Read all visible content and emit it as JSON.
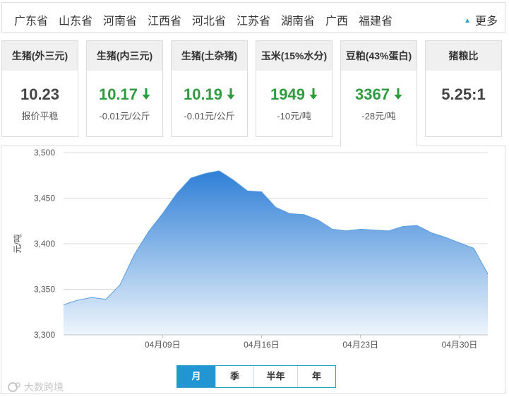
{
  "provinces": [
    "广东省",
    "山东省",
    "河南省",
    "江西省",
    "河北省",
    "江苏省",
    "湖南省",
    "广西",
    "福建省"
  ],
  "more_label": "更多",
  "cards": [
    {
      "title": "生猪(外三元)",
      "value": "10.23",
      "sub": "报价平稳",
      "trend": "flat"
    },
    {
      "title": "生猪(内三元)",
      "value": "10.17",
      "sub": "-0.01元/公斤",
      "trend": "down"
    },
    {
      "title": "生猪(土杂猪)",
      "value": "10.19",
      "sub": "-0.01元/公斤",
      "trend": "down"
    },
    {
      "title": "玉米(15%水分)",
      "value": "1949",
      "sub": "-10元/吨",
      "trend": "down"
    },
    {
      "title": "豆粕(43%蛋白)",
      "value": "3367",
      "sub": "-28元/吨",
      "trend": "down"
    },
    {
      "title": "猪粮比",
      "value": "5.25:1",
      "sub": "",
      "trend": "flat"
    }
  ],
  "active_card": 4,
  "colors": {
    "down": "#2e9b3e",
    "accent": "#2196d3",
    "area_top": "#2f7fd6",
    "area_bottom": "#eef5fc"
  },
  "chart_data": {
    "type": "area",
    "ylabel": "元/吨",
    "ylim": [
      3300,
      3500
    ],
    "yticks": [
      "3,500",
      "3,450",
      "3,400",
      "3,350",
      "3,300"
    ],
    "ytick_values": [
      3500,
      3450,
      3400,
      3350,
      3300
    ],
    "xtick_labels": [
      "04月09日",
      "04月16日",
      "04月23日",
      "04月30日"
    ],
    "xtick_index": [
      7,
      14,
      21,
      28
    ],
    "x": [
      "04月02日",
      "04月03日",
      "04月04日",
      "04月05日",
      "04月06日",
      "04月07日",
      "04月08日",
      "04月09日",
      "04月10日",
      "04月11日",
      "04月12日",
      "04月13日",
      "04月14日",
      "04月15日",
      "04月16日",
      "04月17日",
      "04月18日",
      "04月19日",
      "04月20日",
      "04月21日",
      "04月22日",
      "04月23日",
      "04月24日",
      "04月25日",
      "04月26日",
      "04月27日",
      "04月28日",
      "04月29日",
      "04月30日",
      "05月01日",
      "05月02日"
    ],
    "values": [
      3333,
      3338,
      3341,
      3339,
      3355,
      3388,
      3413,
      3433,
      3455,
      3472,
      3477,
      3480,
      3470,
      3458,
      3457,
      3440,
      3433,
      3432,
      3426,
      3416,
      3414,
      3416,
      3415,
      3414,
      3419,
      3420,
      3412,
      3407,
      3401,
      3395,
      3367
    ],
    "grid": true,
    "legend": "none"
  },
  "period_tabs": [
    "月",
    "季",
    "半年",
    "年"
  ],
  "active_period": 0,
  "watermark": "大数跨境"
}
